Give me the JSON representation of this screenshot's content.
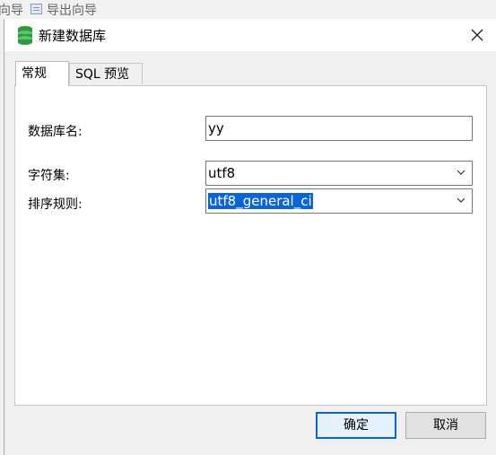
{
  "background": {
    "left_text": "向导",
    "export_label": "导出向导"
  },
  "dialog": {
    "title": "新建数据库",
    "close_glyph": "✕"
  },
  "tabs": [
    {
      "label": "常规",
      "active": true
    },
    {
      "label": "SQL 预览",
      "active": false
    }
  ],
  "form": {
    "db_name_label": "数据库名:",
    "db_name_value": "yy",
    "charset_label": "字符集:",
    "charset_value": "utf8",
    "collation_label": "排序规则:",
    "collation_value": "utf8_general_ci"
  },
  "buttons": {
    "ok": "确定",
    "cancel": "取消"
  },
  "colors": {
    "accent": "#0a64d8",
    "db_icon": "#2e9a3f"
  },
  "icons": {
    "db": "database-icon",
    "export": "export-icon",
    "close": "close-icon",
    "dropdown": "chevron-down-icon"
  }
}
